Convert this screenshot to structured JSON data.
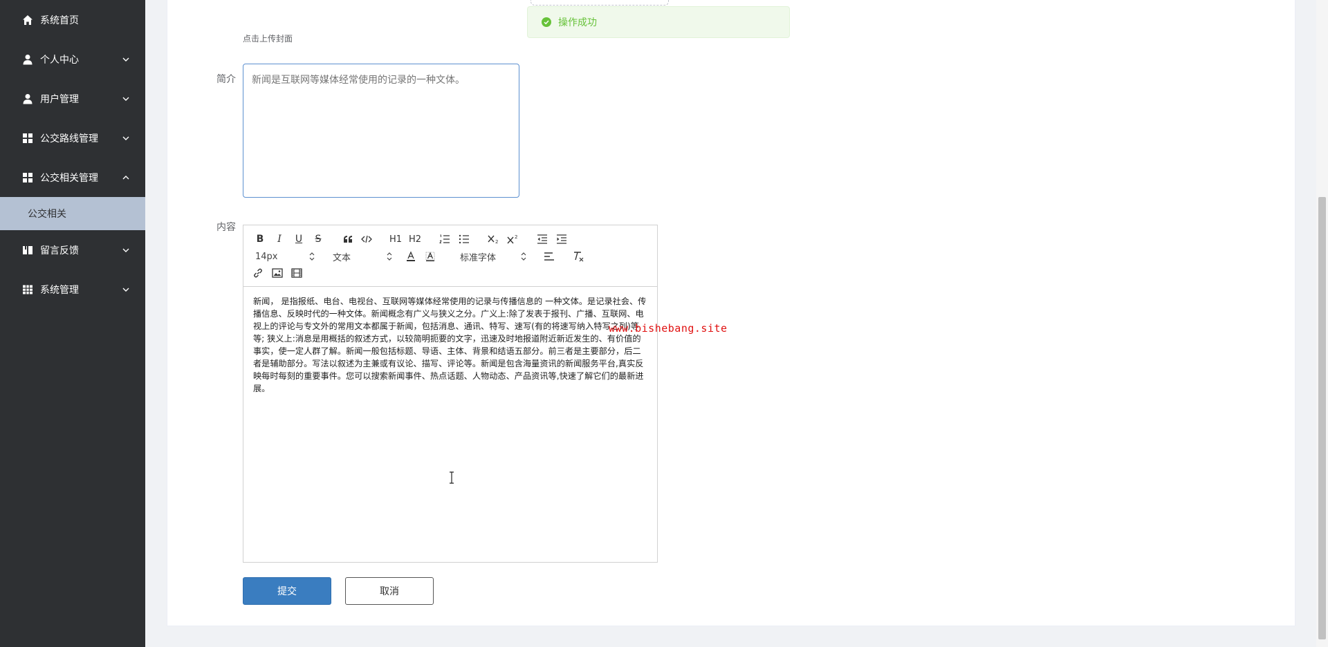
{
  "sidebar": {
    "items": [
      {
        "label": "系统首页",
        "icon": "home-icon",
        "expandable": false
      },
      {
        "label": "个人中心",
        "icon": "user-icon",
        "expandable": true,
        "expanded": false
      },
      {
        "label": "用户管理",
        "icon": "user-icon",
        "expandable": true,
        "expanded": false
      },
      {
        "label": "公交路线管理",
        "icon": "grid-icon",
        "expandable": true,
        "expanded": false
      },
      {
        "label": "公交相关管理",
        "icon": "grid-icon",
        "expandable": true,
        "expanded": true
      },
      {
        "label": "留言反馈",
        "icon": "book-icon",
        "expandable": true,
        "expanded": false
      },
      {
        "label": "系统管理",
        "icon": "table-icon",
        "expandable": true,
        "expanded": false
      }
    ],
    "active_submenu": "公交相关",
    "colors": {
      "background": "#2e3033",
      "active_submenu_bg": "#b4c1d3"
    }
  },
  "toast": {
    "message": "操作成功",
    "color": "#67c23a"
  },
  "form": {
    "cover_hint": "点击上传封面",
    "summary_label": "简介",
    "summary_placeholder": "新闻是互联网等媒体经常使用的记录的一种文体。",
    "content_label": "内容",
    "editor": {
      "toolbar": {
        "font_size": "14px",
        "header_select": "文本",
        "font_family": "标准字体",
        "buttons": [
          "B",
          "I",
          "U",
          "S",
          "H1",
          "H2"
        ]
      },
      "content": "新闻， 是指报纸、电台、电视台、互联网等媒体经常使用的记录与传播信息的 一种文体。是记录社会、传播信息、反映时代的一种文体。新闻概念有广义与狭义之分。广义上:除了发表于报刊、广播、互联网、电视上的评论与专文外的常用文本都属于新闻，包括消息、通讯、特写、速写(有的将速写纳入特写之列)等等; 狭义上:消息是用概括的叙述方式，以较简明扼要的文字，迅速及时地报道附近新近发生的、有价值的事实，使一定人群了解。新闻一般包括标题、导语、主体、背景和结语五部分。前三者是主要部分，后二者是辅助部分。写法以叙述为主兼或有议论、描写、评论等。新闻是包含海量资讯的新闻服务平台,真实反映每时每刻的重要事件。您可以搜索新闻事件、热点话题、人物动态、产品资讯等,快速了解它们的最新进展。"
    },
    "submit_label": "提交",
    "cancel_label": "取消"
  },
  "watermark": "www.bishebang.site",
  "colors": {
    "primary": "#3a7dc0",
    "success": "#67c23a",
    "watermark": "#e01010"
  }
}
